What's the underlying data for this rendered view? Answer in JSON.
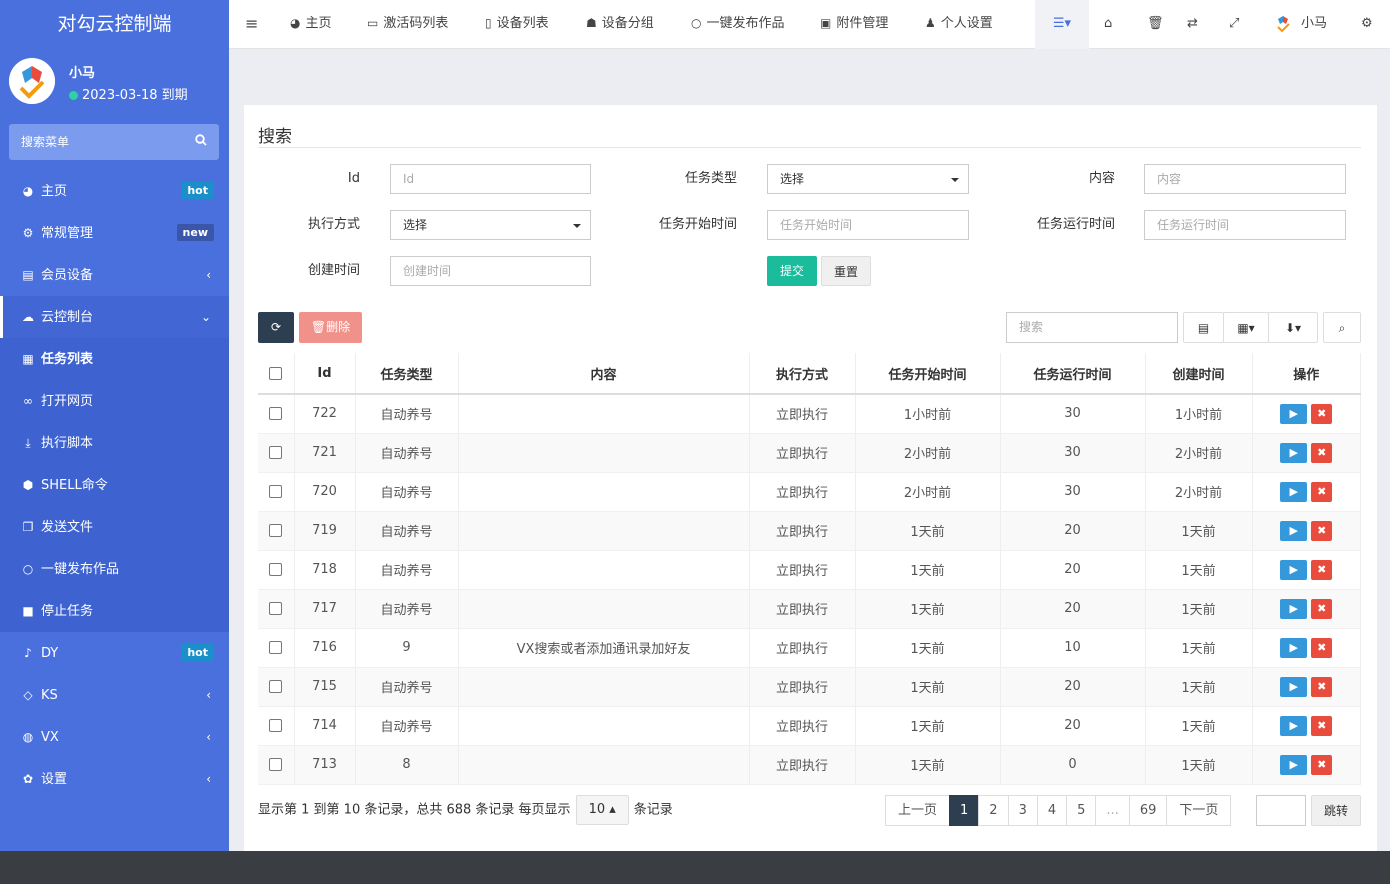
{
  "brand": "对勾云控制端",
  "user": {
    "name": "小马",
    "expiry": "2023-03-18 到期"
  },
  "sidebar": {
    "search": "搜索菜单",
    "items": [
      {
        "label": "主页",
        "icon": "dashboard-icon",
        "badge": "hot"
      },
      {
        "label": "常规管理",
        "icon": "cogs-icon",
        "badge": "new"
      },
      {
        "label": "会员设备",
        "icon": "id-card-icon",
        "arrow": "‹"
      },
      {
        "label": "云控制台",
        "icon": "cloud-icon",
        "arrow": "⌄"
      },
      {
        "label": "任务列表",
        "icon": "table-icon"
      },
      {
        "label": "打开网页",
        "icon": "link-icon"
      },
      {
        "label": "执行脚本",
        "icon": "download-icon"
      },
      {
        "label": "SHELL命令",
        "icon": "shell-icon"
      },
      {
        "label": "发送文件",
        "icon": "file-icon"
      },
      {
        "label": "一键发布作品",
        "icon": "circle-icon"
      },
      {
        "label": "停止任务",
        "icon": "stop-icon"
      },
      {
        "label": "DY",
        "icon": "music-icon",
        "badge": "hot"
      },
      {
        "label": "KS",
        "icon": "eye-icon",
        "arrow": "‹"
      },
      {
        "label": "VX",
        "icon": "wechat-icon",
        "arrow": "‹"
      },
      {
        "label": "设置",
        "icon": "gear-icon",
        "arrow": "‹"
      }
    ]
  },
  "topnav": {
    "items": [
      "主页",
      "激活码列表",
      "设备列表",
      "设备分组",
      "一键发布作品",
      "附件管理",
      "个人设置"
    ],
    "user": "小马"
  },
  "search": {
    "title": "搜索",
    "labels": {
      "id": "Id",
      "type": "任务类型",
      "content": "内容",
      "exec": "执行方式",
      "start": "任务开始时间",
      "run": "任务运行时间",
      "created": "创建时间"
    },
    "placeholders": {
      "id": "Id",
      "content": "内容",
      "start": "任务开始时间",
      "run": "任务运行时间",
      "created": "创建时间"
    },
    "select_value": "选择",
    "submit": "提交",
    "reset": "重置"
  },
  "toolbar": {
    "delete": "删除",
    "search_placeholder": "搜索"
  },
  "table": {
    "headers": [
      "Id",
      "任务类型",
      "内容",
      "执行方式",
      "任务开始时间",
      "任务运行时间",
      "创建时间",
      "操作"
    ],
    "rows": [
      [
        "722",
        "自动养号",
        "",
        "立即执行",
        "1小时前",
        "30",
        "1小时前"
      ],
      [
        "721",
        "自动养号",
        "",
        "立即执行",
        "2小时前",
        "30",
        "2小时前"
      ],
      [
        "720",
        "自动养号",
        "",
        "立即执行",
        "2小时前",
        "30",
        "2小时前"
      ],
      [
        "719",
        "自动养号",
        "",
        "立即执行",
        "1天前",
        "20",
        "1天前"
      ],
      [
        "718",
        "自动养号",
        "",
        "立即执行",
        "1天前",
        "20",
        "1天前"
      ],
      [
        "717",
        "自动养号",
        "",
        "立即执行",
        "1天前",
        "20",
        "1天前"
      ],
      [
        "716",
        "9",
        "VX搜索或者添加通讯录加好友",
        "立即执行",
        "1天前",
        "10",
        "1天前"
      ],
      [
        "715",
        "自动养号",
        "",
        "立即执行",
        "1天前",
        "20",
        "1天前"
      ],
      [
        "714",
        "自动养号",
        "",
        "立即执行",
        "1天前",
        "20",
        "1天前"
      ],
      [
        "713",
        "8",
        "",
        "立即执行",
        "1天前",
        "0",
        "1天前"
      ]
    ]
  },
  "pagination": {
    "info_prefix": "显示第 1 到第 10 条记录，总共 688 条记录 每页显示",
    "page_size": "10",
    "info_suffix": "条记录",
    "prev": "上一页",
    "pages": [
      "1",
      "2",
      "3",
      "4",
      "5",
      "...",
      "69"
    ],
    "next": "下一页",
    "jump": "跳转"
  },
  "colors": {
    "sidebar": "#4a70de",
    "primary": "#2c3e50",
    "success": "#1abc9c",
    "danger": "#e74c3c",
    "info": "#3498db"
  }
}
